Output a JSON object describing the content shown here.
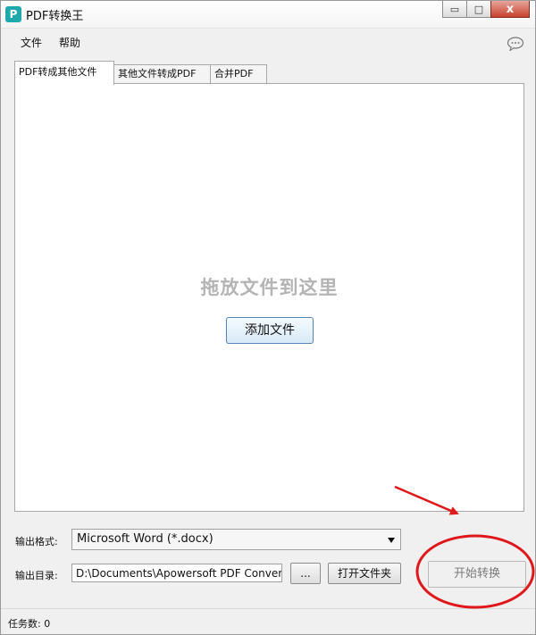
{
  "window": {
    "title": "PDF转换王",
    "app_icon_glyph": "P",
    "controls": {
      "minimize": "▭",
      "maximize": "□",
      "close": "x"
    }
  },
  "menu": {
    "items": [
      "文件",
      "帮助"
    ]
  },
  "tabs": [
    {
      "label": "PDF转成其他文件",
      "active": true
    },
    {
      "label": "其他文件转成PDF",
      "active": false
    },
    {
      "label": "合并PDF",
      "active": false
    }
  ],
  "drop_area": {
    "hint": "拖放文件到这里",
    "add_button": "添加文件"
  },
  "output": {
    "format_label": "输出格式:",
    "format_value": "Microsoft Word (*.docx)",
    "dir_label": "输出目录:",
    "dir_value": "D:\\Documents\\Apowersoft PDF Conver",
    "browse_button": "...",
    "open_folder_button": "打开文件夹"
  },
  "start_button": "开始转换",
  "status": {
    "task_count": "任务数: 0"
  },
  "colors": {
    "annotation": "#e0181b",
    "app_icon": "#20a9ad"
  }
}
